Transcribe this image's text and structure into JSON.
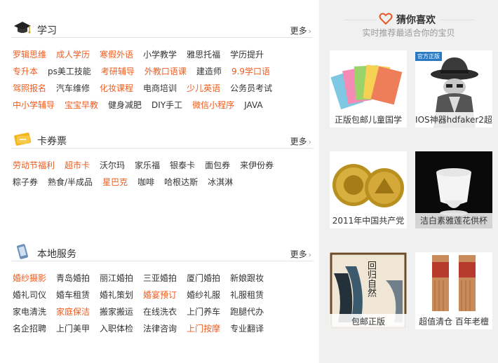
{
  "sections": [
    {
      "title": "学习",
      "more": "更多",
      "rows": [
        [
          {
            "t": "罗辑思维",
            "hot": true
          },
          {
            "t": "成人学历",
            "hot": true
          },
          {
            "t": "寒假外语",
            "hot": true
          },
          {
            "t": "小学教学",
            "hot": false
          },
          {
            "t": "雅思托福",
            "hot": false
          },
          {
            "t": "学历提升",
            "hot": false
          }
        ],
        [
          {
            "t": "专升本",
            "hot": true
          },
          {
            "t": "ps美工技能",
            "hot": false
          },
          {
            "t": "考研辅导",
            "hot": true
          },
          {
            "t": "外教口语课",
            "hot": true
          },
          {
            "t": "建造师",
            "hot": false
          },
          {
            "t": "9.9学口语",
            "hot": true
          }
        ],
        [
          {
            "t": "驾照报名",
            "hot": true
          },
          {
            "t": "汽车维修",
            "hot": false
          },
          {
            "t": "化妆课程",
            "hot": true
          },
          {
            "t": "电商培训",
            "hot": false
          },
          {
            "t": "少儿英语",
            "hot": true
          },
          {
            "t": "公务员考试",
            "hot": false
          }
        ],
        [
          {
            "t": "中小学辅导",
            "hot": true
          },
          {
            "t": "宝宝早教",
            "hot": true
          },
          {
            "t": "健身减肥",
            "hot": false
          },
          {
            "t": "DIY手工",
            "hot": false
          },
          {
            "t": "微信小程序",
            "hot": true
          },
          {
            "t": "JAVA",
            "hot": false
          }
        ]
      ]
    },
    {
      "title": "卡券票",
      "more": "更多",
      "rows": [
        [
          {
            "t": "劳动节福利",
            "hot": true
          },
          {
            "t": "超市卡",
            "hot": true
          },
          {
            "t": "沃尔玛",
            "hot": false
          },
          {
            "t": "家乐福",
            "hot": false
          },
          {
            "t": "银泰卡",
            "hot": false
          },
          {
            "t": "面包券",
            "hot": false
          },
          {
            "t": "来伊份券",
            "hot": false
          }
        ],
        [
          {
            "t": "粽子券",
            "hot": false
          },
          {
            "t": "熟食/半成品",
            "hot": false
          },
          {
            "t": "星巴克",
            "hot": true
          },
          {
            "t": "咖啡",
            "hot": false
          },
          {
            "t": "哈根达斯",
            "hot": false
          },
          {
            "t": "冰淇淋",
            "hot": false
          }
        ]
      ]
    },
    {
      "title": "本地服务",
      "more": "更多",
      "rows": [
        [
          {
            "t": "婚纱摄影",
            "hot": true
          },
          {
            "t": "青岛婚拍",
            "hot": false
          },
          {
            "t": "丽江婚拍",
            "hot": false
          },
          {
            "t": "三亚婚拍",
            "hot": false
          },
          {
            "t": "厦门婚拍",
            "hot": false
          },
          {
            "t": "新娘跟妆",
            "hot": false
          }
        ],
        [
          {
            "t": "婚礼司仪",
            "hot": false
          },
          {
            "t": "婚车租赁",
            "hot": false
          },
          {
            "t": "婚礼策划",
            "hot": false
          },
          {
            "t": "婚宴预订",
            "hot": true
          },
          {
            "t": "婚纱礼服",
            "hot": false
          },
          {
            "t": "礼服租赁",
            "hot": false
          }
        ],
        [
          {
            "t": "家电清洗",
            "hot": false
          },
          {
            "t": "家庭保洁",
            "hot": true
          },
          {
            "t": "搬家搬运",
            "hot": false
          },
          {
            "t": "在线洗衣",
            "hot": false
          },
          {
            "t": "上门养车",
            "hot": false
          },
          {
            "t": "跑腿代办",
            "hot": false
          }
        ],
        [
          {
            "t": "名企招聘",
            "hot": false
          },
          {
            "t": "上门美甲",
            "hot": false
          },
          {
            "t": "入职体检",
            "hot": false
          },
          {
            "t": "法律咨询",
            "hot": false
          },
          {
            "t": "上门按摩",
            "hot": true
          },
          {
            "t": "专业翻译",
            "hot": false
          }
        ]
      ]
    }
  ],
  "guess": {
    "title": "猜你喜欢",
    "subtitle": "实时推荐最适合你的宝贝",
    "items": [
      {
        "caption": "正版包邮儿童国学",
        "icon": "flashcards-image"
      },
      {
        "caption": "IOS神器hdfaker2超",
        "icon": "spy-hat-image",
        "badge": "官方正版"
      },
      {
        "caption": "2011年中国共产党",
        "icon": "gold-coin-image"
      },
      {
        "caption": "洁白素雅莲花供杯",
        "icon": "white-cup-image"
      },
      {
        "caption": "包邮正版",
        "icon": "book-cover-image",
        "cover_text": "回归自然"
      },
      {
        "caption": "超值清仓 百年老檀",
        "icon": "incense-image"
      }
    ]
  },
  "colors": {
    "hot": "#f05b1d",
    "normal": "#333333",
    "accent": "#e8582a"
  }
}
